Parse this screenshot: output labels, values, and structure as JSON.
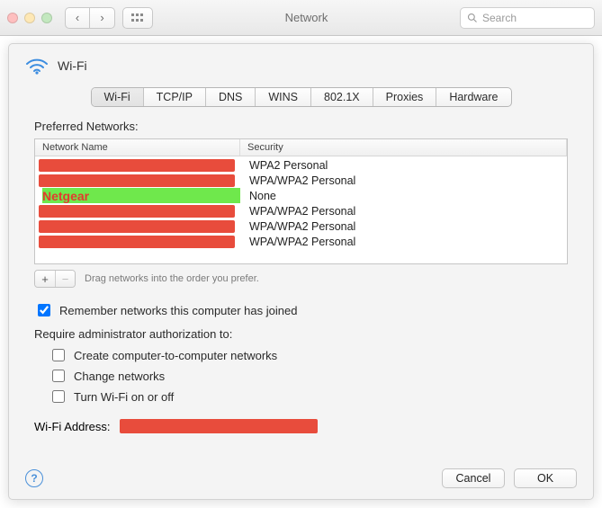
{
  "toolbar": {
    "title": "Network",
    "search_placeholder": "Search"
  },
  "header": {
    "title": "Wi-Fi"
  },
  "tabs": [
    "Wi-Fi",
    "TCP/IP",
    "DNS",
    "WINS",
    "802.1X",
    "Proxies",
    "Hardware"
  ],
  "active_tab_index": 0,
  "preferred_label": "Preferred Networks:",
  "columns": {
    "name": "Network Name",
    "security": "Security"
  },
  "networks": [
    {
      "name_redacted": true,
      "name": "",
      "security": "WPA2 Personal",
      "highlight": false
    },
    {
      "name_redacted": true,
      "name": "",
      "security": "WPA/WPA2 Personal",
      "highlight": false
    },
    {
      "name_redacted": false,
      "name": "Netgear",
      "security": "None",
      "highlight": true
    },
    {
      "name_redacted": true,
      "name": "",
      "security": "WPA/WPA2 Personal",
      "highlight": false
    },
    {
      "name_redacted": true,
      "name": "",
      "security": "WPA/WPA2 Personal",
      "highlight": false
    },
    {
      "name_redacted": true,
      "name": "",
      "security": "WPA/WPA2 Personal",
      "highlight": false
    }
  ],
  "plus_minus": {
    "drag_hint": "Drag networks into the order you prefer."
  },
  "remember": {
    "checked": true,
    "label": "Remember networks this computer has joined"
  },
  "admin": {
    "label": "Require administrator authorization to:",
    "opts": [
      {
        "checked": false,
        "label": "Create computer-to-computer networks"
      },
      {
        "checked": false,
        "label": "Change networks"
      },
      {
        "checked": false,
        "label": "Turn Wi-Fi on or off"
      }
    ]
  },
  "wifi_address_label": "Wi-Fi Address:",
  "buttons": {
    "cancel": "Cancel",
    "ok": "OK"
  }
}
